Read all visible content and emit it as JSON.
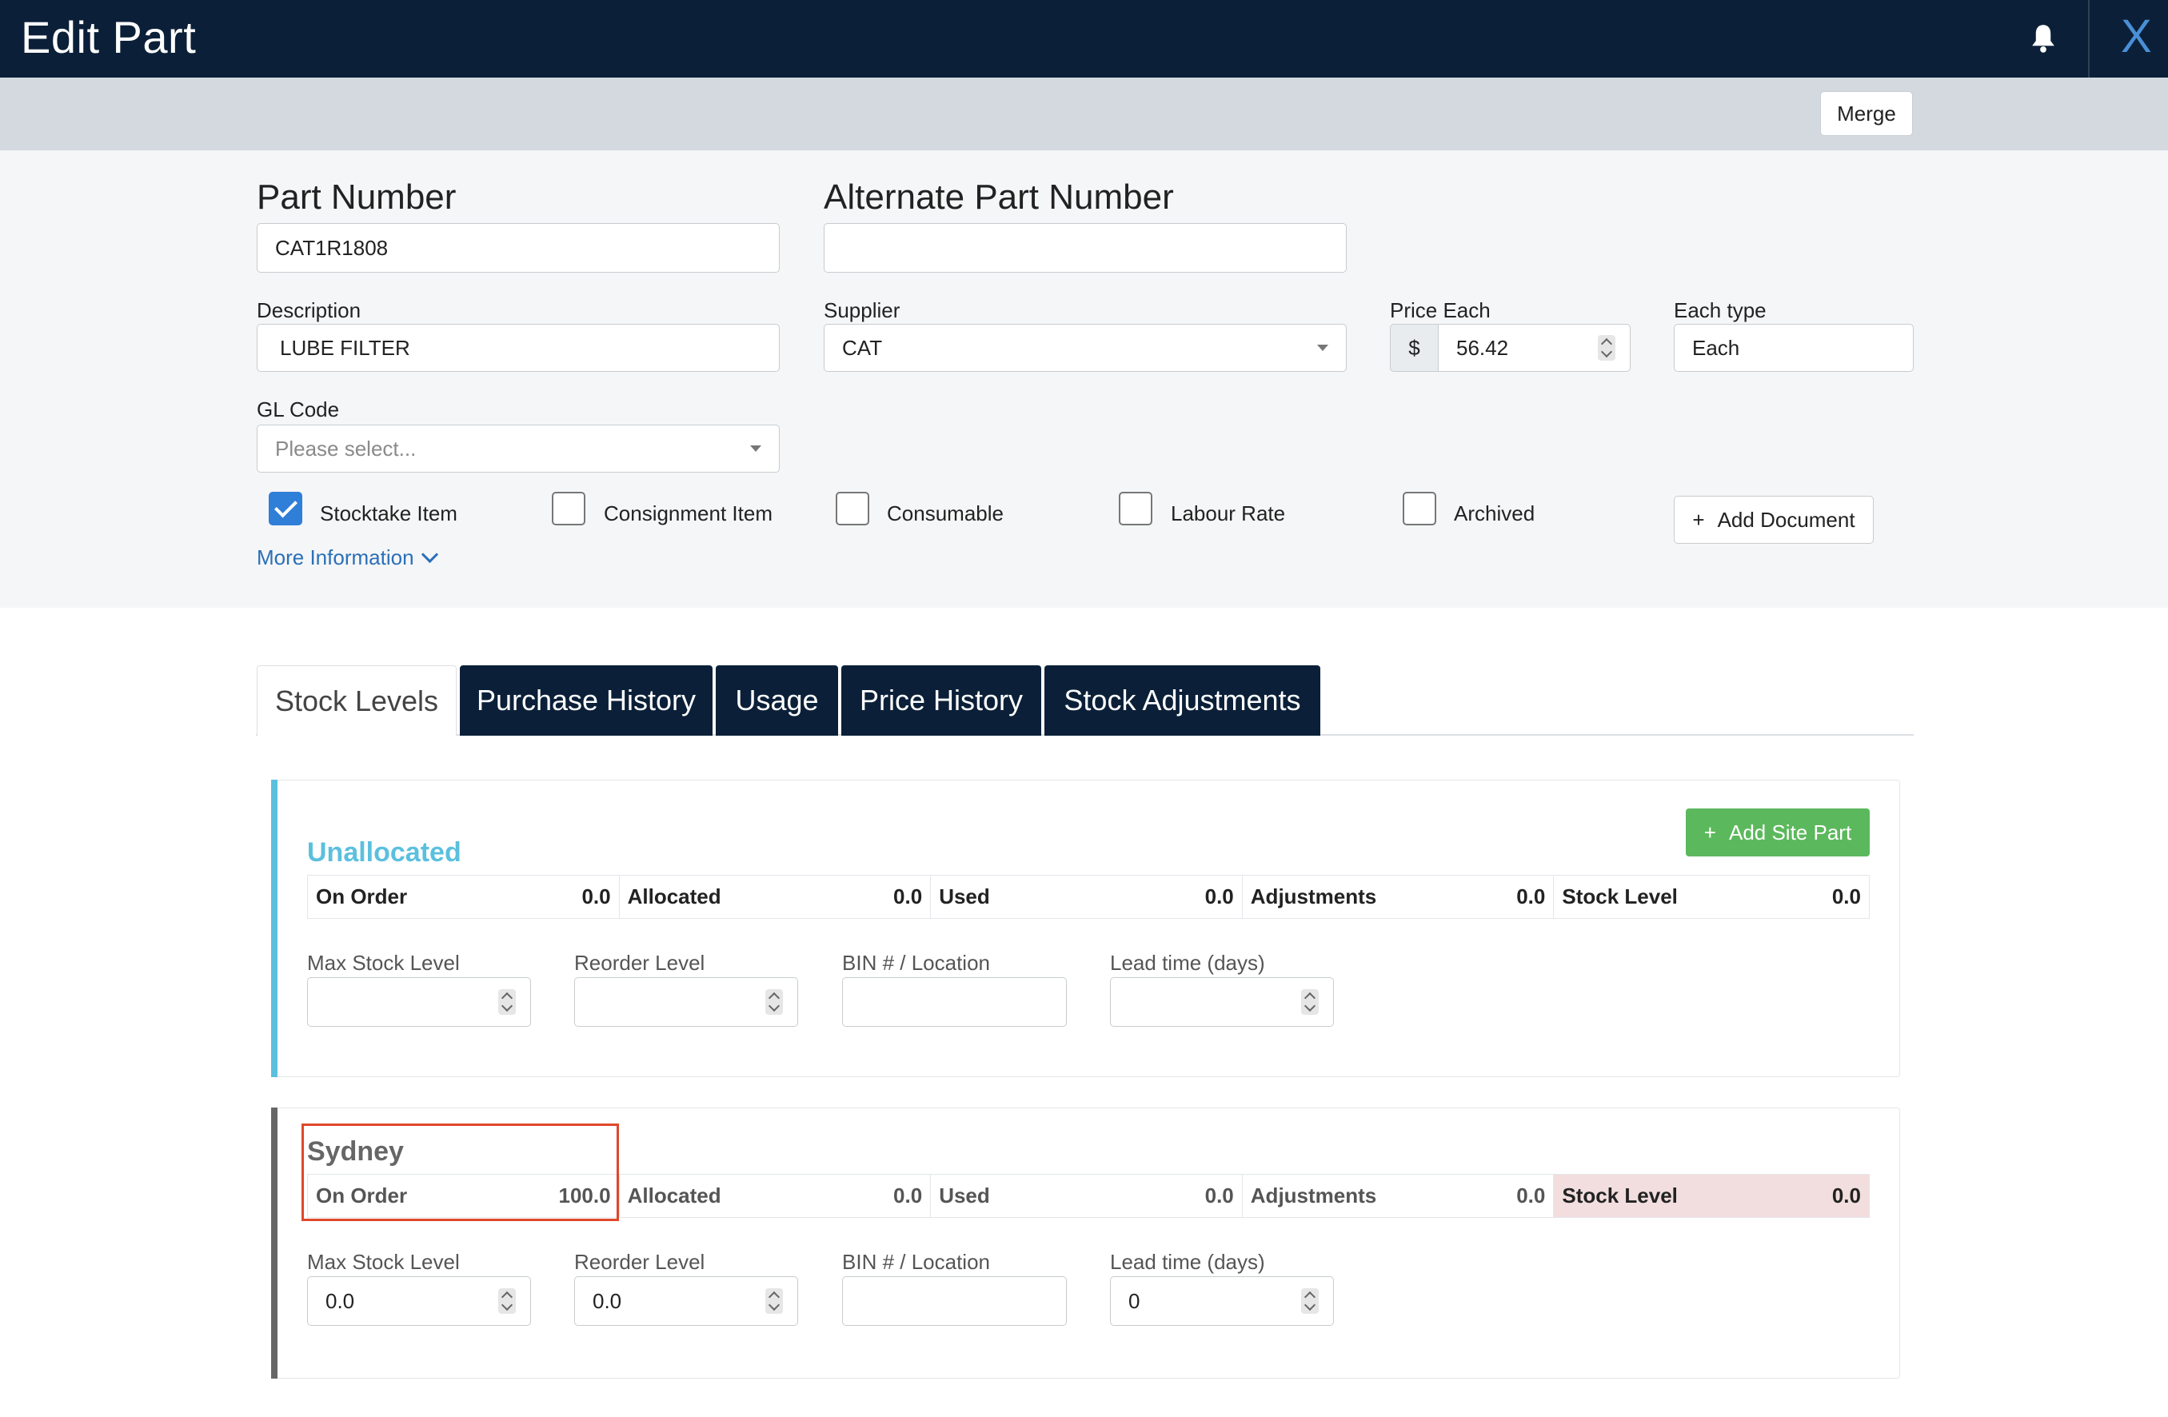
{
  "header": {
    "title": "Edit Part",
    "close_label": "X"
  },
  "actions": {
    "merge_label": "Merge"
  },
  "form": {
    "part_number": {
      "label": "Part Number",
      "value": "CAT1R1808"
    },
    "alternate_part_number": {
      "label": "Alternate Part Number",
      "value": ""
    },
    "description": {
      "label": "Description",
      "value": "LUBE FILTER"
    },
    "supplier": {
      "label": "Supplier",
      "value": "CAT"
    },
    "price_each": {
      "label": "Price Each",
      "currency": "$",
      "value": "56.42"
    },
    "each_type": {
      "label": "Each type",
      "value": "Each"
    },
    "gl_code": {
      "label": "GL Code",
      "placeholder": "Please select..."
    },
    "checkboxes": [
      {
        "label": "Stocktake Item",
        "checked": true
      },
      {
        "label": "Consignment Item",
        "checked": false
      },
      {
        "label": "Consumable",
        "checked": false
      },
      {
        "label": "Labour Rate",
        "checked": false
      },
      {
        "label": "Archived",
        "checked": false
      }
    ],
    "more_info_label": "More Information",
    "add_document_label": "Add Document"
  },
  "tabs": [
    {
      "label": "Stock Levels",
      "active": true
    },
    {
      "label": "Purchase History",
      "active": false
    },
    {
      "label": "Usage",
      "active": false
    },
    {
      "label": "Price History",
      "active": false
    },
    {
      "label": "Stock Adjustments",
      "active": false
    }
  ],
  "sites": [
    {
      "name": "Unallocated",
      "color": "#5bc0de",
      "add_site_part_label": "Add Site Part",
      "stats": [
        {
          "label": "On Order",
          "value": "0.0"
        },
        {
          "label": "Allocated",
          "value": "0.0"
        },
        {
          "label": "Used",
          "value": "0.0"
        },
        {
          "label": "Adjustments",
          "value": "0.0"
        },
        {
          "label": "Stock Level",
          "value": "0.0"
        }
      ],
      "fields": [
        {
          "label": "Max Stock Level",
          "value": ""
        },
        {
          "label": "Reorder Level",
          "value": ""
        },
        {
          "label": "BIN # / Location",
          "value": ""
        },
        {
          "label": "Lead time (days)",
          "value": ""
        }
      ]
    },
    {
      "name": "Sydney",
      "color": "#666666",
      "stats": [
        {
          "label": "On Order",
          "value": "100.0"
        },
        {
          "label": "Allocated",
          "value": "0.0"
        },
        {
          "label": "Used",
          "value": "0.0"
        },
        {
          "label": "Adjustments",
          "value": "0.0"
        },
        {
          "label": "Stock Level",
          "value": "0.0"
        }
      ],
      "fields": [
        {
          "label": "Max Stock Level",
          "value": "0.0"
        },
        {
          "label": "Reorder Level",
          "value": "0.0"
        },
        {
          "label": "BIN # / Location",
          "value": ""
        },
        {
          "label": "Lead time (days)",
          "value": "0"
        }
      ]
    }
  ],
  "colors": {
    "header_bg": "#0b2038",
    "action_bar_bg": "#d3d9df",
    "link": "#2a6fb8",
    "checkbox_checked": "#2f7ed8",
    "add_button": "#5cb85c",
    "stock_level_alert_bg": "#f2dede",
    "annotation_box": "#e0472b"
  }
}
